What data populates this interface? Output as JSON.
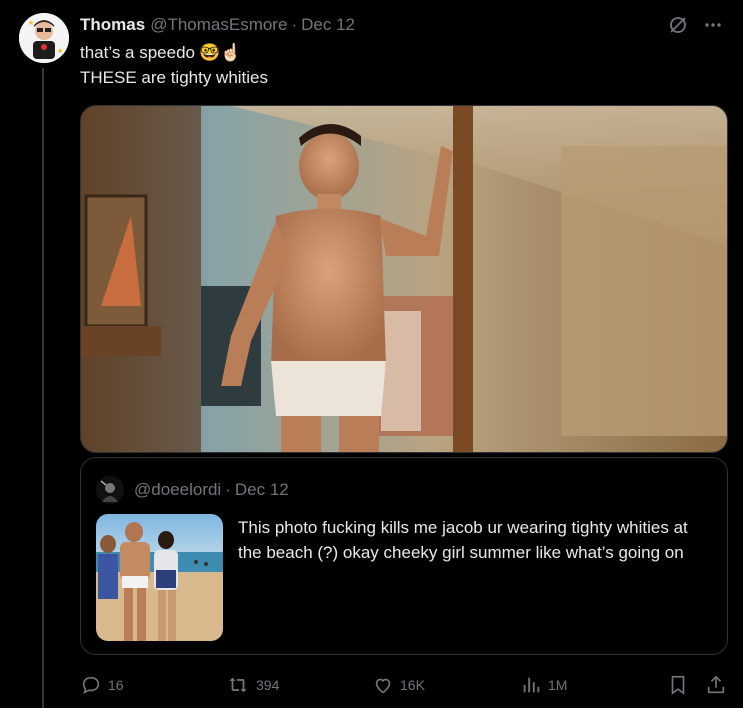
{
  "tweet": {
    "author_name": "Thomas",
    "author_handle": "@ThomasEsmore",
    "separator": "·",
    "date": "Dec 12",
    "text_line1": "that’s a speedo",
    "text_line1_emojis": "🤓☝🏻",
    "text_line2": "THESE are tighty whities"
  },
  "quote": {
    "handle": "@doeelordi",
    "separator": "·",
    "date": "Dec 12",
    "text": "This photo fucking kills me jacob ur wearing tighty whities at the beach (?) okay cheeky girl summer like what’s going on"
  },
  "actions": {
    "replies": "16",
    "reposts": "394",
    "likes": "16K",
    "views": "1M"
  },
  "icons": {
    "header": [
      "grok-slash-icon",
      "more-icon"
    ],
    "actions": [
      "reply-icon",
      "repost-icon",
      "like-icon",
      "views-icon",
      "bookmark-icon",
      "share-icon"
    ]
  },
  "colors": {
    "background": "#000000",
    "text_primary": "#e7e9ea",
    "text_secondary": "#71767b",
    "border": "#2f3336"
  }
}
